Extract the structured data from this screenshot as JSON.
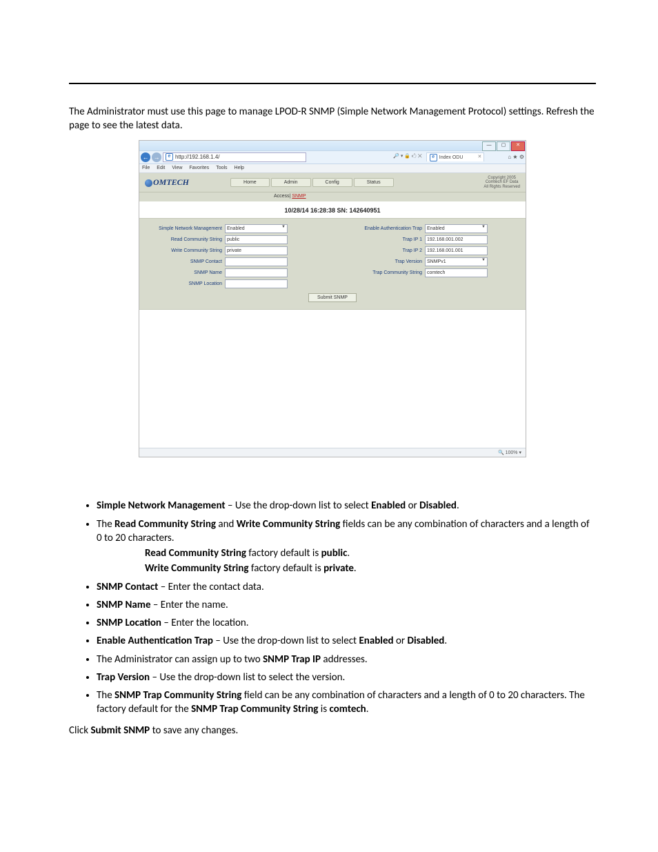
{
  "intro": "The Administrator must use this page to manage LPOD-R SNMP (Simple Network Management Protocol) settings. Refresh the page to see the latest data.",
  "browser": {
    "url": "http://192.168.1.4/",
    "search_hint": "🔎 ▾  🔒 🖒 ✕",
    "tab_title": "Index ODU",
    "menu": [
      "File",
      "Edit",
      "View",
      "Favorites",
      "Tools",
      "Help"
    ]
  },
  "app": {
    "logo_text": "OMTECH",
    "tabs": [
      "Home",
      "Admin",
      "Config",
      "Status"
    ],
    "sub_prefix": "Access| ",
    "sub_link": "SNMP",
    "copyright": "Copyright 2005\nComtech EF Data\nAll Rights Reserved",
    "timestamp": "10/28/14  16:28:38  SN: 142640951"
  },
  "left_fields": [
    {
      "label": "Simple Network Management",
      "value": "Enabled",
      "type": "sel"
    },
    {
      "label": "Read Community String",
      "value": "public",
      "type": "txt"
    },
    {
      "label": "Write Community String",
      "value": "private",
      "type": "txt"
    },
    {
      "label": "SNMP Contact",
      "value": "",
      "type": "txt"
    },
    {
      "label": "SNMP Name",
      "value": "",
      "type": "txt"
    },
    {
      "label": "SNMP Location",
      "value": "",
      "type": "txt"
    }
  ],
  "right_fields": [
    {
      "label": "Enable Authentication Trap",
      "value": "Enabled",
      "type": "sel"
    },
    {
      "label": "Trap IP 1",
      "value": "192.168.001.002",
      "type": "txt"
    },
    {
      "label": "Trap IP 2",
      "value": "192.168.001.001",
      "type": "txt"
    },
    {
      "label": "Trap Version",
      "value": "SNMPv1",
      "type": "sel"
    },
    {
      "label": "Trap Community String",
      "value": "comtech",
      "type": "txt"
    }
  ],
  "submit_label": "Submit SNMP",
  "zoom": "🔍 100%  ▾",
  "bullets": {
    "b1a": "Simple Network Management",
    "b1b": " – Use the drop-down list to select ",
    "b1c": "Enabled",
    "b1d": " or ",
    "b1e": "Disabled",
    "b1f": ".",
    "b2a": "The ",
    "b2b": "Read Community String",
    "b2c": " and ",
    "b2d": "Write Community String",
    "b2e": " fields can be any combination of characters and a length of 0 to 20 characters.",
    "b2sub1a": "Read Community String",
    "b2sub1b": " factory default is ",
    "b2sub1c": "public",
    "b2sub1d": ".",
    "b2sub2a": "Write Community String",
    "b2sub2b": " factory default is ",
    "b2sub2c": "private",
    "b2sub2d": ".",
    "b3a": "SNMP Contact",
    "b3b": " – Enter the contact data.",
    "b4a": "SNMP Name",
    "b4b": " – Enter the name.",
    "b5a": "SNMP Location",
    "b5b": " – Enter the location.",
    "b6a": "Enable Authentication Trap",
    "b6b": " – Use the drop-down list to select ",
    "b6c": "Enabled",
    "b6d": " or ",
    "b6e": "Disabled",
    "b6f": ".",
    "b7a": "The Administrator can assign up to two ",
    "b7b": "SNMP Trap IP",
    "b7c": " addresses.",
    "b8a": "Trap Version",
    "b8b": " – Use the drop-down list to select the version.",
    "b9a": "The ",
    "b9b": "SNMP Trap Community String",
    "b9c": " field can be any combination of characters and a length of 0 to 20 characters. The factory default for the ",
    "b9d": "SNMP Trap Community String",
    "b9e": " is ",
    "b9f": "comtech",
    "b9g": "."
  },
  "closing_a": "Click ",
  "closing_b": "Submit SNMP",
  "closing_c": " to save any changes."
}
